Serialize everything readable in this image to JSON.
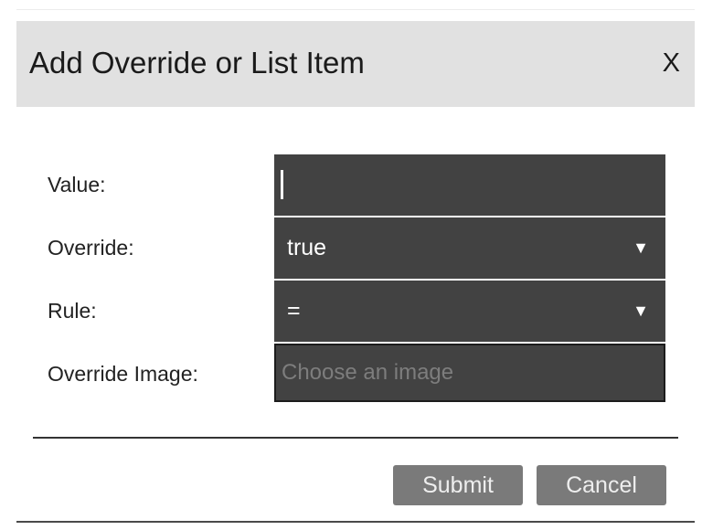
{
  "dialog": {
    "title": "Add Override or List Item",
    "close_label": "X"
  },
  "form": {
    "value": {
      "label": "Value:",
      "current_value": ""
    },
    "override": {
      "label": "Override:",
      "selected": "true",
      "arrow": "▼"
    },
    "rule": {
      "label": "Rule:",
      "selected": "=",
      "arrow": "▼"
    },
    "override_image": {
      "label": "Override Image:",
      "placeholder": "Choose an image"
    }
  },
  "footer": {
    "submit_label": "Submit",
    "cancel_label": "Cancel"
  },
  "colors": {
    "header_bg": "#e1e1e1",
    "field_bg": "#424242",
    "button_bg": "#7a7a7a"
  }
}
